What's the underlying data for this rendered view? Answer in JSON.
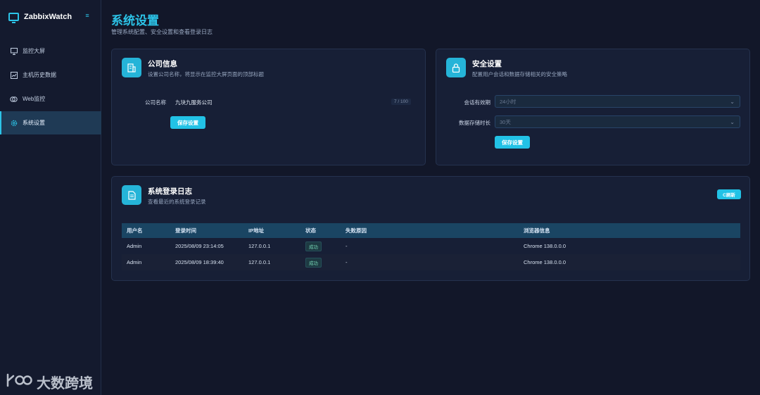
{
  "app": {
    "name": "ZabbixWatch"
  },
  "sidebar": {
    "items": [
      {
        "label": "监控大屏",
        "icon": "monitor-icon",
        "active": false
      },
      {
        "label": "主机历史数据",
        "icon": "chart-icon",
        "active": false
      },
      {
        "label": "Web监控",
        "icon": "web-icon",
        "active": false
      },
      {
        "label": "系统设置",
        "icon": "gear-icon",
        "active": true
      }
    ]
  },
  "page": {
    "title": "系统设置",
    "subtitle": "管理系统配置、安全设置和查看登录日志"
  },
  "company_card": {
    "title": "公司信息",
    "desc": "设置公司名称，将显示在监控大屏页面的顶部标题",
    "field_label": "公司名称",
    "field_value": "九块九服务公司",
    "counter": "7 / 100",
    "save_label": "保存设置"
  },
  "security_card": {
    "title": "安全设置",
    "desc": "配置用户会话和数据存储相关的安全策略",
    "session_label": "会话有效期",
    "session_value": "24小时",
    "retention_label": "数据存储时长",
    "retention_value": "30天",
    "save_label": "保存设置"
  },
  "log_card": {
    "title": "系统登录日志",
    "desc": "查看最近的系统登录记录",
    "refresh_label": "C刷新",
    "columns": [
      "用户名",
      "登录时间",
      "IP地址",
      "状态",
      "失败原因",
      "浏览器信息"
    ],
    "rows": [
      {
        "user": "Admin",
        "time": "2025/08/09 23:14:05",
        "ip": "127.0.0.1",
        "status": "成功",
        "reason": "-",
        "browser": "Chrome 138.0.0.0"
      },
      {
        "user": "Admin",
        "time": "2025/08/09 18:39:40",
        "ip": "127.0.0.1",
        "status": "成功",
        "reason": "-",
        "browser": "Chrome 138.0.0.0"
      }
    ]
  },
  "watermark": {
    "text": "大数跨境"
  },
  "colors": {
    "accent": "#22c2e6",
    "background": "#121729",
    "card": "#171f36"
  }
}
